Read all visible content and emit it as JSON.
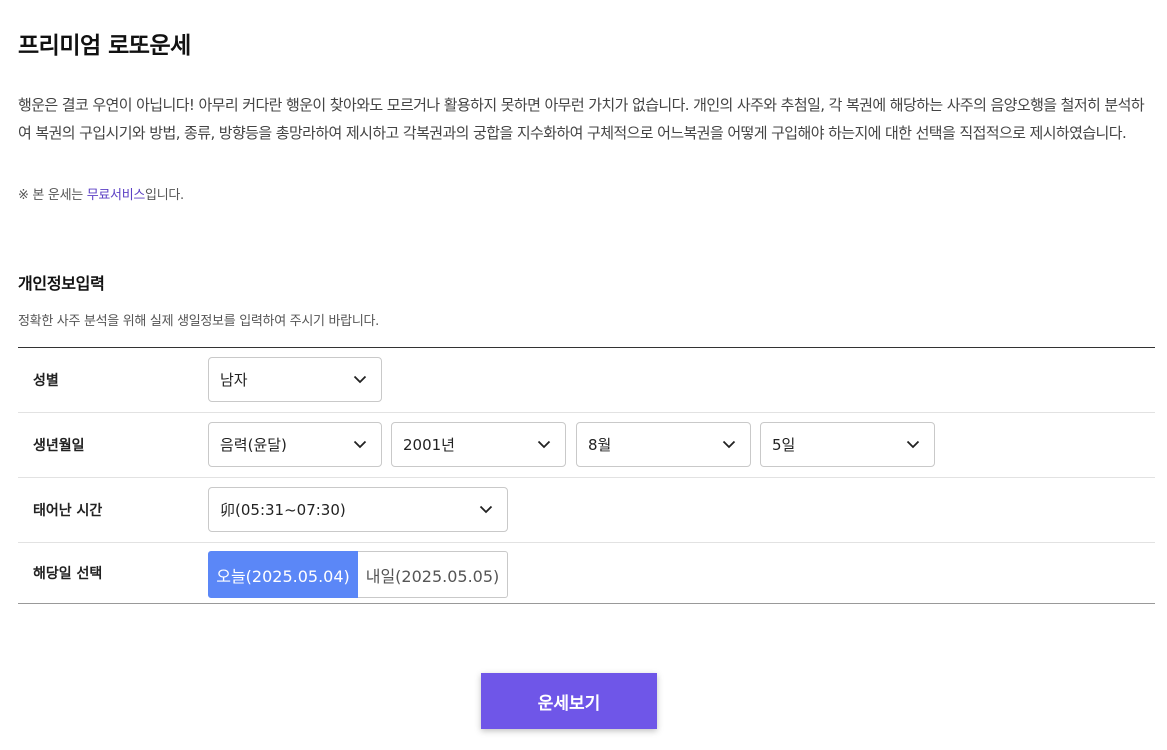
{
  "page": {
    "title": "프리미엄 로또운세",
    "description": "행운은 결코 우연이 아닙니다! 아무리 커다란 행운이 찾아와도 모르거나 활용하지 못하면 아무런 가치가 없습니다. 개인의 사주와 추첨일, 각 복권에 해당하는 사주의 음양오행을 철저히 분석하여 복권의 구입시기와 방법, 종류, 방향등을 총망라하여 제시하고 각복권과의 궁합을 지수화하여 구체적으로 어느복권을 어떻게 구입해야 하는지에 대한 선택을 직접적으로 제시하였습니다.",
    "notice_prefix": "※ 본 운세는 ",
    "notice_highlight": "무료서비스",
    "notice_suffix": "입니다."
  },
  "section": {
    "title": "개인정보입력",
    "subtitle": "정확한 사주 분석을 위해 실제 생일정보를 입력하여 주시기 바랍니다."
  },
  "form": {
    "gender": {
      "label": "성별",
      "value": "남자"
    },
    "birth": {
      "label": "생년월일",
      "calendar": "음력(윤달)",
      "year": "2001년",
      "month": "8월",
      "day": "5일"
    },
    "birth_time": {
      "label": "태어난 시간",
      "value": "卯(05:31~07:30)"
    },
    "date_select": {
      "label": "해당일 선택",
      "today": "오늘(2025.05.04)",
      "tomorrow": "내일(2025.05.05)",
      "selected": "today"
    }
  },
  "actions": {
    "submit_label": "운세보기"
  },
  "colors": {
    "accent_blue": "#5b87f7",
    "button_purple": "#6f56e8",
    "highlight_purple": "#5b3fc4"
  },
  "icons": {
    "dropdown": "chevron-down-icon"
  }
}
